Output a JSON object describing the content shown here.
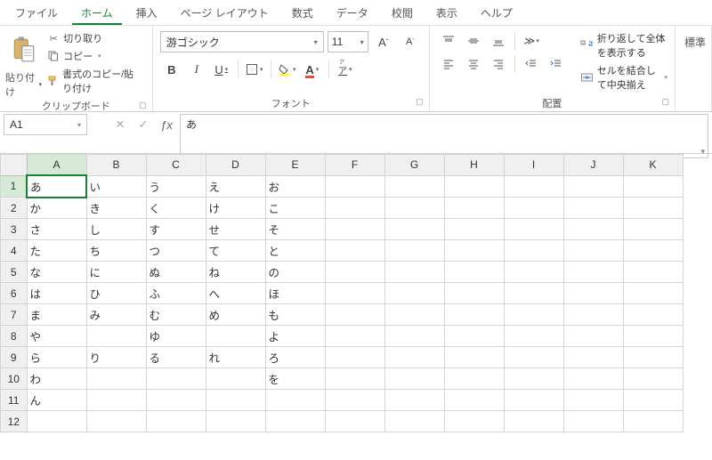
{
  "tabs": [
    "ファイル",
    "ホーム",
    "挿入",
    "ページ レイアウト",
    "数式",
    "データ",
    "校閲",
    "表示",
    "ヘルプ"
  ],
  "active_tab": 1,
  "clipboard": {
    "paste": "貼り付け",
    "cut": "切り取り",
    "copy": "コピー",
    "fmtpaint": "書式のコピー/貼り付け",
    "group": "クリップボード"
  },
  "font": {
    "name": "游ゴシック",
    "size": "11",
    "grow": "A",
    "shrink": "A",
    "bold": "B",
    "italic": "I",
    "underline": "U",
    "ruby": "ア",
    "group": "フォント"
  },
  "align": {
    "group": "配置"
  },
  "wrapmerge": {
    "wrap": "折り返して全体を表示する",
    "merge": "セルを結合して中央揃え"
  },
  "trunc_group": "標準",
  "namebox": "A1",
  "fx_value": "あ",
  "columns": [
    "A",
    "B",
    "C",
    "D",
    "E",
    "F",
    "G",
    "H",
    "I",
    "J",
    "K"
  ],
  "rows": 12,
  "selected": {
    "row": 1,
    "col": 0
  },
  "cells": [
    [
      "あ",
      "い",
      "う",
      "え",
      "お",
      "",
      "",
      "",
      "",
      "",
      ""
    ],
    [
      "か",
      "き",
      "く",
      "け",
      "こ",
      "",
      "",
      "",
      "",
      "",
      ""
    ],
    [
      "さ",
      "し",
      "す",
      "せ",
      "そ",
      "",
      "",
      "",
      "",
      "",
      ""
    ],
    [
      "た",
      "ち",
      "つ",
      "て",
      "と",
      "",
      "",
      "",
      "",
      "",
      ""
    ],
    [
      "な",
      "に",
      "ぬ",
      "ね",
      "の",
      "",
      "",
      "",
      "",
      "",
      ""
    ],
    [
      "は",
      "ひ",
      "ふ",
      "へ",
      "ほ",
      "",
      "",
      "",
      "",
      "",
      ""
    ],
    [
      "ま",
      "み",
      "む",
      "め",
      "も",
      "",
      "",
      "",
      "",
      "",
      ""
    ],
    [
      "や",
      "",
      "ゆ",
      "",
      "よ",
      "",
      "",
      "",
      "",
      "",
      ""
    ],
    [
      "ら",
      "り",
      "る",
      "れ",
      "ろ",
      "",
      "",
      "",
      "",
      "",
      ""
    ],
    [
      "わ",
      "",
      "",
      "",
      "を",
      "",
      "",
      "",
      "",
      "",
      ""
    ],
    [
      "ん",
      "",
      "",
      "",
      "",
      "",
      "",
      "",
      "",
      "",
      ""
    ],
    [
      "",
      "",
      "",
      "",
      "",
      "",
      "",
      "",
      "",
      "",
      ""
    ]
  ]
}
